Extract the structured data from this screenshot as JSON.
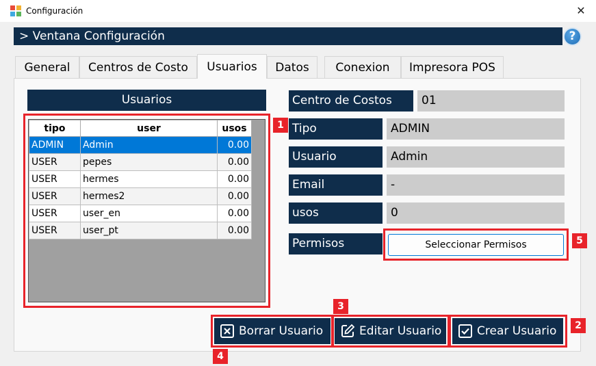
{
  "window": {
    "title": "Configuración",
    "close_glyph": "✕"
  },
  "header": {
    "title": "> Ventana Configuración",
    "help_glyph": "?"
  },
  "tabs": [
    {
      "label": "General"
    },
    {
      "label": "Centros de Costo"
    },
    {
      "label": "Usuarios",
      "active": true
    },
    {
      "label": "Datos"
    },
    {
      "label": "Conexion"
    },
    {
      "label": "Impresora POS"
    }
  ],
  "users_panel": {
    "title": "Usuarios",
    "columns": [
      "tipo",
      "user",
      "usos"
    ],
    "rows": [
      {
        "tipo": "ADMIN",
        "user": "Admin",
        "usos": "0.00",
        "selected": true
      },
      {
        "tipo": "USER",
        "user": "pepes",
        "usos": "0.00"
      },
      {
        "tipo": "USER",
        "user": "hermes",
        "usos": "0.00"
      },
      {
        "tipo": "USER",
        "user": "hermes2",
        "usos": "0.00"
      },
      {
        "tipo": "USER",
        "user": "user_en",
        "usos": "0.00"
      },
      {
        "tipo": "USER",
        "user": "user_pt",
        "usos": "0.00"
      }
    ]
  },
  "details": {
    "centro_label": "Centro de Costos",
    "centro_value": "01",
    "tipo_label": "Tipo",
    "tipo_value": "ADMIN",
    "usuario_label": "Usuario",
    "usuario_value": "Admin",
    "email_label": "Email",
    "email_value": "-",
    "usos_label": "usos",
    "usos_value": "0",
    "permisos_label": "Permisos",
    "permisos_button": "Seleccionar Permisos"
  },
  "actions": {
    "borrar": "Borrar Usuario",
    "editar": "Editar Usuario",
    "crear": "Crear Usuario"
  },
  "annotations": [
    "1",
    "2",
    "3",
    "4",
    "5"
  ],
  "colors": {
    "navy": "#0f2d4b",
    "highlight": "#e8232a",
    "selection": "#0078d7",
    "value_bg": "#cccccc"
  }
}
